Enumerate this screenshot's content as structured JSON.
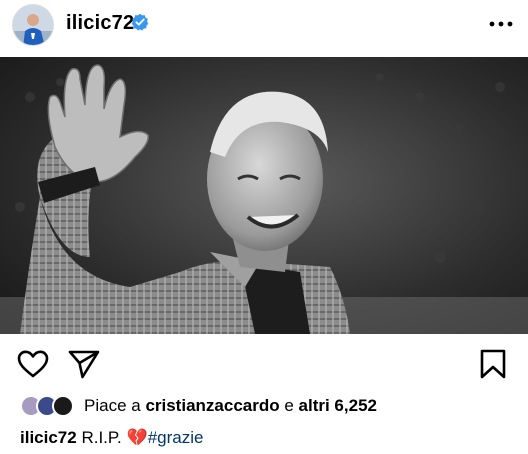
{
  "post": {
    "username": "ilicic72",
    "verified": true,
    "more_icon": "more-horizontal-icon"
  },
  "image": {
    "description_icon": "photo-image"
  },
  "actions": {
    "like_icon": "heart-outline-icon",
    "share_icon": "paper-plane-icon",
    "save_icon": "bookmark-outline-icon"
  },
  "likes": {
    "prefix": "Piace a ",
    "user": "cristianzaccardo",
    "middle": " e ",
    "others": "altri 6,252"
  },
  "caption": {
    "username": "ilicic72",
    "text": "R.I.P.",
    "emoji": "💔",
    "hashtag": "#grazie"
  },
  "colors": {
    "verified": "#3897f0",
    "hashtag": "#00376b",
    "heart": "#d0011b"
  }
}
